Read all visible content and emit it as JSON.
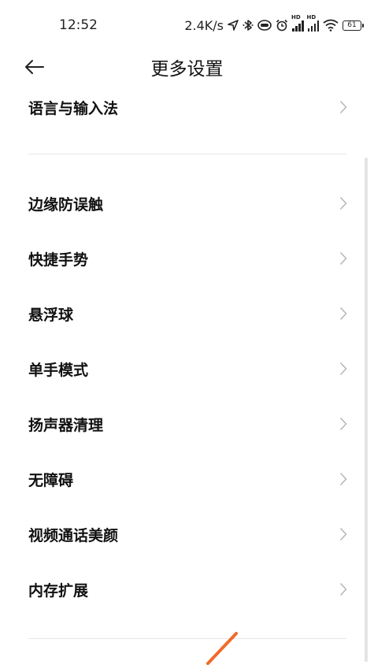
{
  "status_bar": {
    "time": "12:52",
    "net_speed": "2.4K/s",
    "battery": "61",
    "icons": [
      "location-icon",
      "bluetooth-icon",
      "earbuds-icon",
      "alarm-icon",
      "signal-hd-icon",
      "signal-hd-icon",
      "wifi-icon",
      "battery-icon"
    ]
  },
  "header": {
    "title": "更多设置",
    "back_icon": "arrow-left-icon"
  },
  "items": [
    {
      "label": "语言与输入法"
    },
    {
      "label": "边缘防误触"
    },
    {
      "label": "快捷手势"
    },
    {
      "label": "悬浮球"
    },
    {
      "label": "单手模式"
    },
    {
      "label": "扬声器清理"
    },
    {
      "label": "无障碍"
    },
    {
      "label": "视频通话美颜"
    },
    {
      "label": "内存扩展"
    }
  ],
  "colors": {
    "text": "#111111",
    "chevron": "#b5b5b5",
    "divider": "#e6e6e6",
    "annotation": "#f06a2a"
  }
}
